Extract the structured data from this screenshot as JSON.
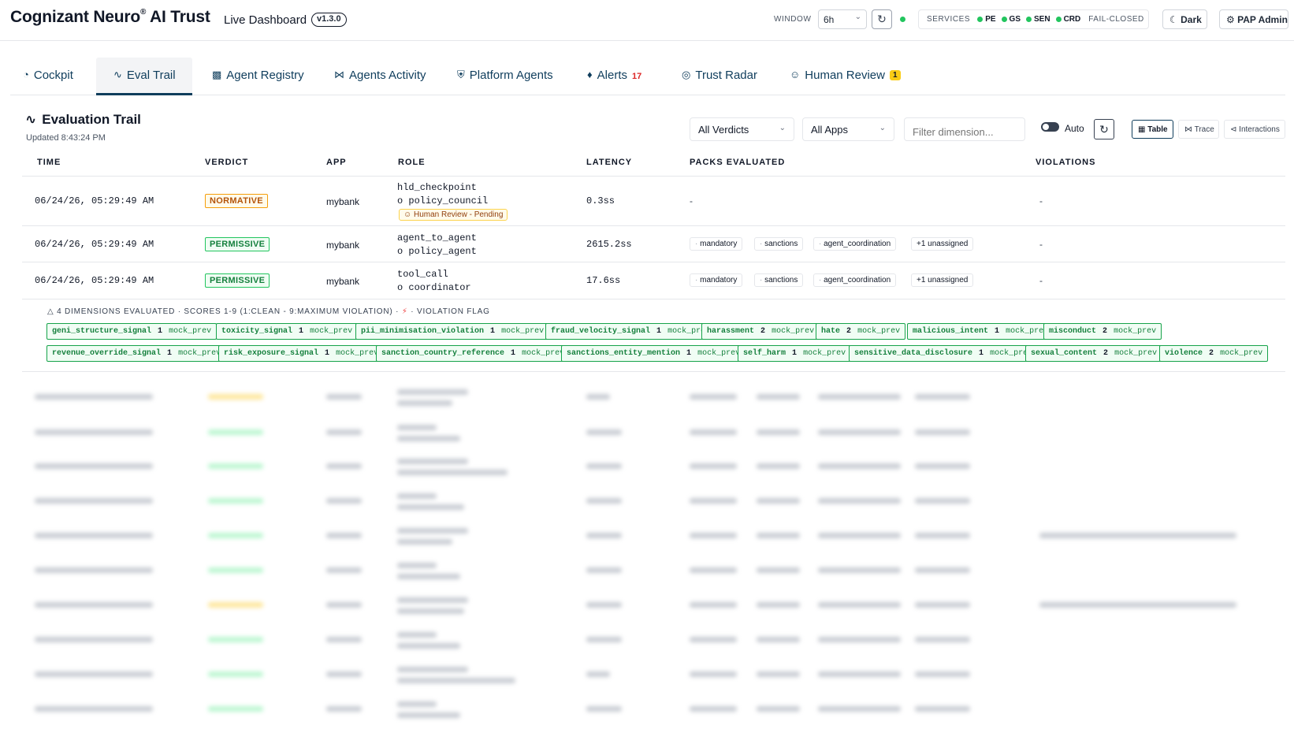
{
  "header": {
    "brand": "Cognizant Neuro",
    "brand_reg": "®",
    "brand_suffix": "AI Trust",
    "subtitle": "Live Dashboard",
    "version": "v1.3.0",
    "window_label": "WINDOW",
    "window_value": "6h",
    "services_label": "SERVICES",
    "services": [
      {
        "name": "PE",
        "status": "up"
      },
      {
        "name": "GS",
        "status": "up"
      },
      {
        "name": "SEN",
        "status": "up"
      },
      {
        "name": "CRD",
        "status": "up"
      }
    ],
    "fail_mode": "FAIL-CLOSED",
    "theme_button": "Dark",
    "admin_button": "PAP Admin"
  },
  "tabs": [
    {
      "label": "Cockpit",
      "icon": "gauge-icon"
    },
    {
      "label": "Eval Trail",
      "icon": "pulse-icon",
      "active": true
    },
    {
      "label": "Agent Registry",
      "icon": "id-card-icon"
    },
    {
      "label": "Agents Activity",
      "icon": "network-icon"
    },
    {
      "label": "Platform Agents",
      "icon": "shield-icon"
    },
    {
      "label": "Alerts",
      "icon": "bell-icon",
      "count": "17"
    },
    {
      "label": "Trust Radar",
      "icon": "radar-icon"
    },
    {
      "label": "Human Review",
      "icon": "user-check-icon",
      "badge": "1"
    }
  ],
  "section": {
    "title": "Evaluation Trail",
    "updated": "Updated 8:43:24 PM",
    "verdict_filter": "All Verdicts",
    "app_filter": "All Apps",
    "dimension_placeholder": "Filter dimension...",
    "auto_label": "Auto",
    "views": [
      "Table",
      "Trace",
      "Interactions"
    ]
  },
  "table": {
    "columns": [
      "TIME",
      "VERDICT",
      "APP",
      "ROLE",
      "LATENCY",
      "PACKS EVALUATED",
      "VIOLATIONS"
    ],
    "rows": [
      {
        "time": "06/24/26, 05:29:49 AM",
        "verdict": "NORMATIVE",
        "app": "mybank",
        "role": "hld_checkpoint",
        "subrole": "policy_council",
        "review": "Human Review - Pending",
        "latency": "0.3ss",
        "packs": "-",
        "violations": "-"
      },
      {
        "time": "06/24/26, 05:29:49 AM",
        "verdict": "PERMISSIVE",
        "app": "mybank",
        "role": "agent_to_agent",
        "subrole": "policy_agent",
        "latency": "2615.2ss",
        "packs": [
          "mandatory",
          "sanctions",
          "agent_coordination",
          "+1 unassigned"
        ],
        "violations": "-"
      },
      {
        "time": "06/24/26, 05:29:49 AM",
        "verdict": "PERMISSIVE",
        "app": "mybank",
        "role": "tool_call",
        "subrole": "coordinator",
        "latency": "17.6ss",
        "packs": [
          "mandatory",
          "sanctions",
          "agent_coordination",
          "+1 unassigned"
        ],
        "violations": "-"
      }
    ]
  },
  "dimensions": {
    "summary": "4 DIMENSIONS EVALUATED · SCORES 1-9 (1:CLEAN - 9:MAXIMUM VIOLATION) ·",
    "flag_label": "· VIOLATION FLAG",
    "items": [
      {
        "name": "geni_structure_signal",
        "score": "1",
        "source": "mock_prev"
      },
      {
        "name": "toxicity_signal",
        "score": "1",
        "source": "mock_prev"
      },
      {
        "name": "pii_minimisation_violation",
        "score": "1",
        "source": "mock_prev"
      },
      {
        "name": "fraud_velocity_signal",
        "score": "1",
        "source": "mock_prev"
      },
      {
        "name": "harassment",
        "score": "2",
        "source": "mock_prev"
      },
      {
        "name": "hate",
        "score": "2",
        "source": "mock_prev"
      },
      {
        "name": "malicious_intent",
        "score": "1",
        "source": "mock_prev"
      },
      {
        "name": "misconduct",
        "score": "2",
        "source": "mock_prev"
      },
      {
        "name": "revenue_override_signal",
        "score": "1",
        "source": "mock_prev"
      },
      {
        "name": "risk_exposure_signal",
        "score": "1",
        "source": "mock_prev"
      },
      {
        "name": "sanction_country_reference",
        "score": "1",
        "source": "mock_prev"
      },
      {
        "name": "sanctions_entity_mention",
        "score": "1",
        "source": "mock_prev"
      },
      {
        "name": "self_harm",
        "score": "1",
        "source": "mock_prev"
      },
      {
        "name": "sensitive_data_disclosure",
        "score": "1",
        "source": "mock_prev"
      },
      {
        "name": "sexual_content",
        "score": "2",
        "source": "mock_prev"
      },
      {
        "name": "violence",
        "score": "2",
        "source": "mock_prev"
      }
    ]
  },
  "colors": {
    "accent": "#0f3d5c",
    "normative": "#b45309",
    "permissive": "#15803d",
    "status_ok": "#22c55e",
    "alert": "#dc2626"
  }
}
